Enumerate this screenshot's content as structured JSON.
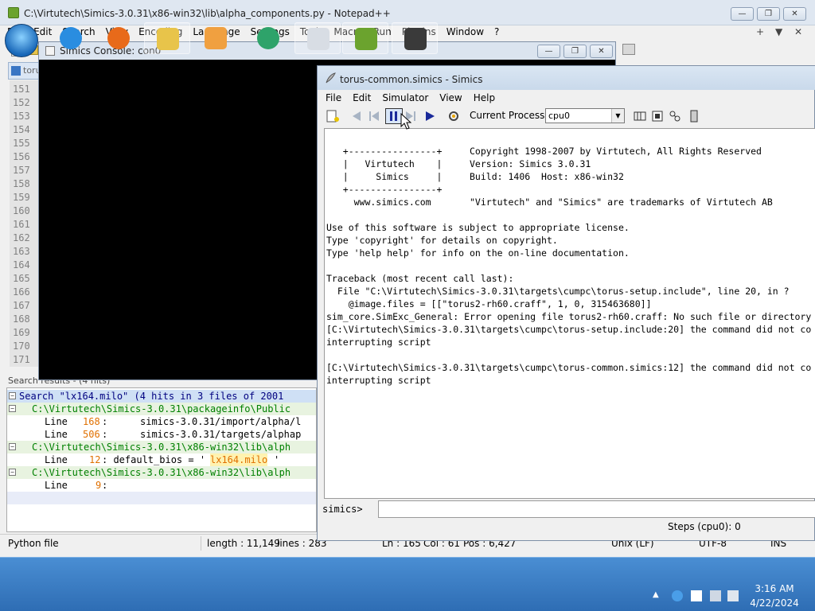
{
  "npp": {
    "title": "C:\\Virtutech\\Simics-3.0.31\\x86-win32\\lib\\alpha_components.py - Notepad++",
    "menu": [
      "File",
      "Edit",
      "Search",
      "View",
      "Encoding",
      "Language",
      "Settings",
      "Tools",
      "Macro",
      "Run",
      "Plugins",
      "Window",
      "?"
    ],
    "menu_extra": [
      "+",
      "▼",
      "✕"
    ],
    "tab_label": "toru",
    "line_numbers": [
      "151",
      "152",
      "153",
      "154",
      "155",
      "156",
      "157",
      "158",
      "159",
      "160",
      "161",
      "162",
      "163",
      "164",
      "165",
      "166",
      "167",
      "168",
      "169",
      "170",
      "171"
    ],
    "search_header": "Search results - (4 hits)",
    "search_results": {
      "summary": "Search \"lx164.milo\" (4 hits in 3 files of 2001",
      "file1": "C:\\Virtutech\\Simics-3.0.31\\packageinfo\\Public",
      "line1_num": "168",
      "line1_text": "simics-3.0.31/import/alpha/l",
      "line2_num": "506",
      "line2_text": "simics-3.0.31/targets/alphap",
      "file2": "C:\\Virtutech\\Simics-3.0.31\\x86-win32\\lib\\alph",
      "line3_num": "12",
      "line3_prefix": ": default_bios = '",
      "line3_hit": "lx164.milo",
      "line3_suffix": "'",
      "file3": "C:\\Virtutech\\Simics-3.0.31\\x86-win32\\lib\\alph",
      "line4_num": "9",
      "line4_text": ":",
      "line_word": "Line"
    },
    "status": {
      "type": "Python file",
      "length": "length : 11,149",
      "lines": "lines : 283",
      "ln": "Ln : 165",
      "col": "Col : 61",
      "pos": "Pos : 6,427",
      "eol": "Unix (LF)",
      "enc": "UTF-8",
      "ins": "INS"
    }
  },
  "console": {
    "title": "Simics Console: con0"
  },
  "simics": {
    "title": "torus-common.simics - Simics",
    "menu": [
      "File",
      "Edit",
      "Simulator",
      "View",
      "Help"
    ],
    "processor_label": "Current Processor:",
    "processor_value": "cpu0",
    "output": [
      "   +----------------+     Copyright 1998-2007 by Virtutech, All Rights Reserved",
      "   |   Virtutech    |     Version: Simics 3.0.31",
      "   |     Simics     |     Build: 1406  Host: x86-win32",
      "   +----------------+",
      "     www.simics.com       \"Virtutech\" and \"Simics\" are trademarks of Virtutech AB",
      "",
      "Use of this software is subject to appropriate license.",
      "Type 'copyright' for details on copyright.",
      "Type 'help help' for info on the on-line documentation.",
      "",
      "Traceback (most recent call last):",
      "  File \"C:\\Virtutech\\Simics-3.0.31\\targets\\cumpc\\torus-setup.include\", line 20, in ?",
      "    @image.files = [[\"torus2-rh60.craff\", 1, 0, 315463680]]",
      "sim_core.SimExc_General: Error opening file torus2-rh60.craff: No such file or directory",
      "[C:\\Virtutech\\Simics-3.0.31\\targets\\cumpc\\torus-setup.include:20] the command did not co",
      "interrupting script",
      "",
      "[C:\\Virtutech\\Simics-3.0.31\\targets\\cumpc\\torus-common.simics:12] the command did not co",
      "interrupting script"
    ],
    "prompt": "simics>",
    "steps": "Steps (cpu0): 0"
  },
  "taskbar": {
    "time": "3:16 AM",
    "date": "4/22/2024"
  },
  "colors": {
    "console_bg": "#000000",
    "search_highlight_bg": "#cfe0f5",
    "green_path": "#008000",
    "hit_orange": "#e07000",
    "taskbar": "#2e6db4"
  }
}
